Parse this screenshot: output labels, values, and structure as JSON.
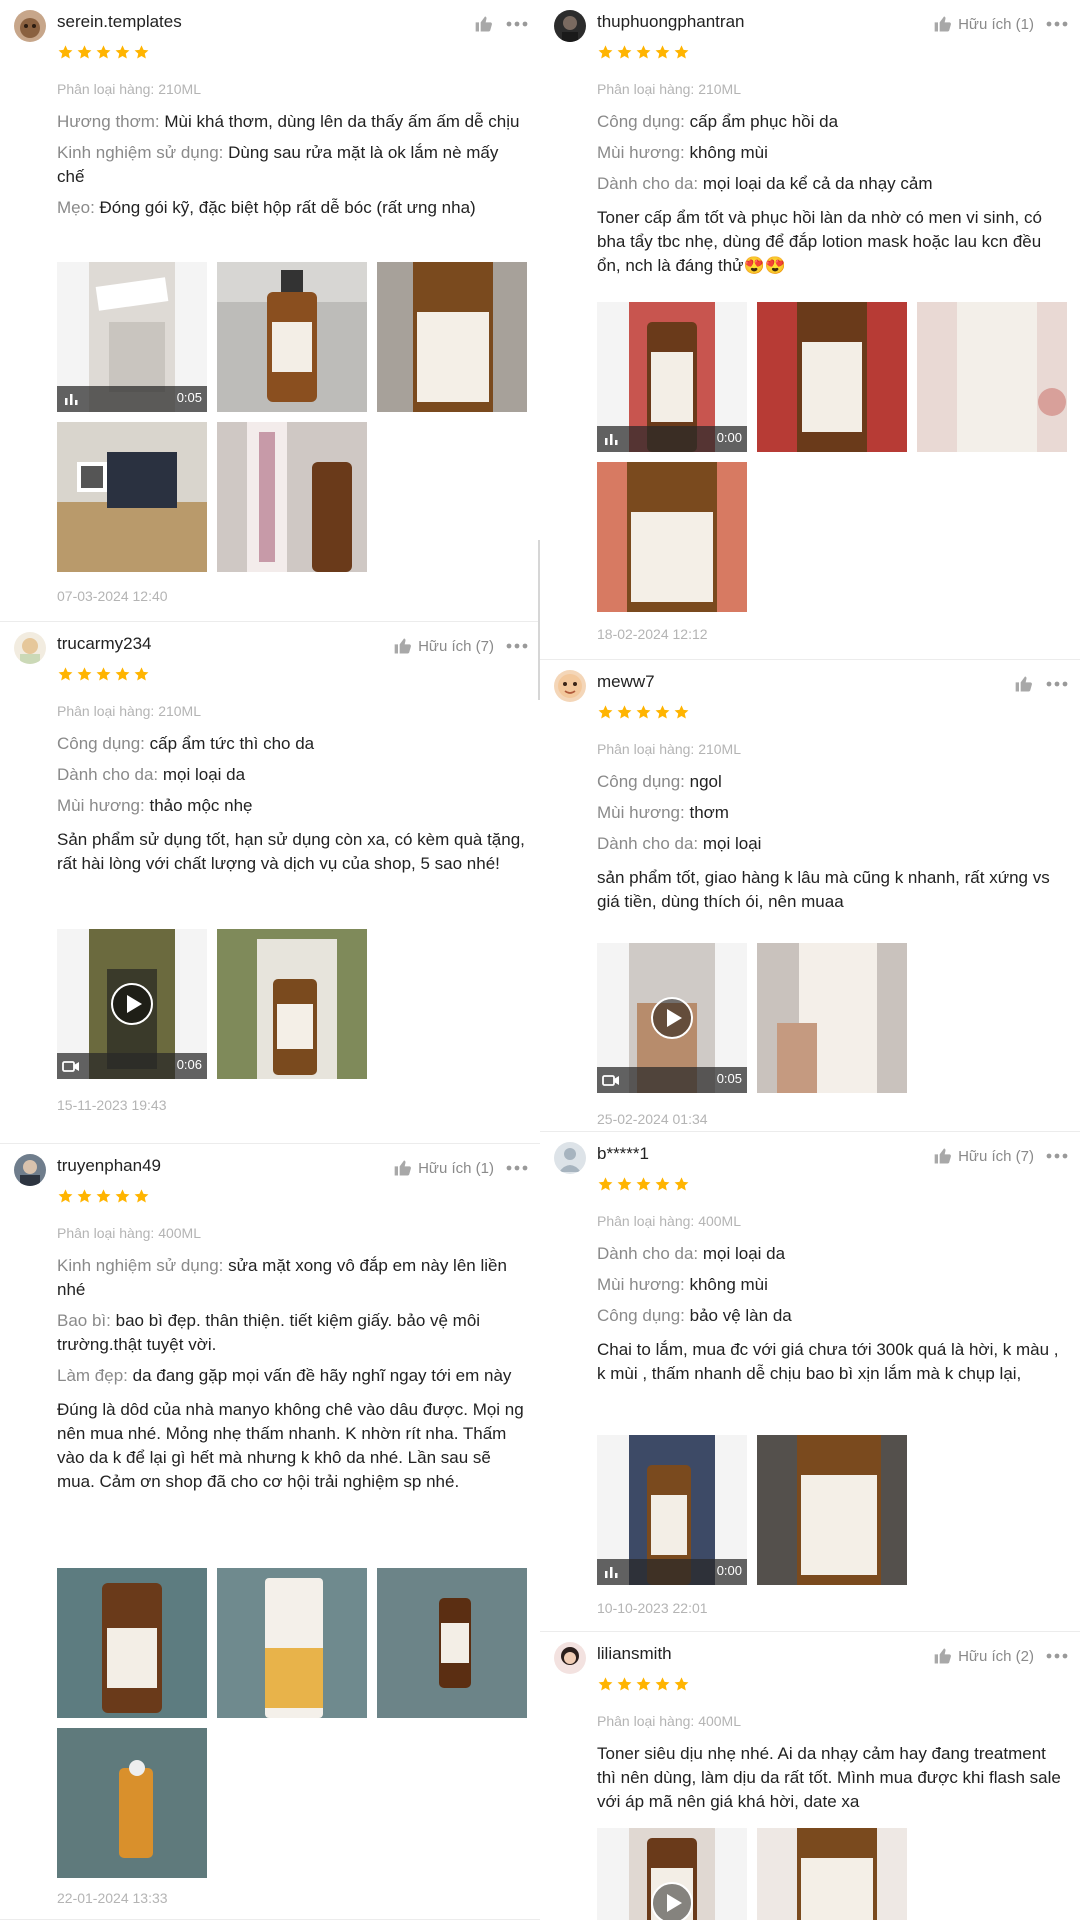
{
  "reviews": [
    {
      "username": "serein.templates",
      "helpful": "",
      "variant": "Phân loại hàng: 210ML",
      "attrs": [
        {
          "k": "Hương thơm: ",
          "v": "Mùi khá thơm, dùng lên da thấy ấm ấm dễ chịu"
        },
        {
          "k": "Kinh nghiệm sử dụng: ",
          "v": "Dùng sau rửa mặt là ok lắm nè mấy chế"
        },
        {
          "k": "Mẹo: ",
          "v": "Đóng gói kỹ, đặc biệt hộp rất dễ bóc (rất ưng nha)"
        }
      ],
      "body": "",
      "video_duration": "0:05",
      "date": "07-03-2024 12:40"
    },
    {
      "username": "trucarmy234",
      "helpful": "Hữu ích (7)",
      "variant": "Phân loại hàng: 210ML",
      "attrs": [
        {
          "k": "Công dụng: ",
          "v": "cấp ẩm tức thì cho da"
        },
        {
          "k": "Dành cho da: ",
          "v": "mọi loại da"
        },
        {
          "k": "Mùi hương: ",
          "v": "thảo mộc nhẹ"
        }
      ],
      "body": "Sản phẩm sử dụng tốt, hạn sử dụng còn xa, có kèm quà tặng, rất hài lòng với chất lượng và dịch vụ của shop, 5 sao nhé!",
      "video_duration": "0:06",
      "date": "15-11-2023 19:43"
    },
    {
      "username": "truyenphan49",
      "helpful": "Hữu ích (1)",
      "variant": "Phân loại hàng: 400ML",
      "attrs": [
        {
          "k": "Kinh nghiệm sử dụng: ",
          "v": "sửa mặt xong vô đắp em này lên liền nhé"
        },
        {
          "k": "Bao bì: ",
          "v": "bao bì đẹp. thân thiện. tiết kiệm giấy. bảo vệ môi trường.thật tuyệt vời."
        },
        {
          "k": "Làm đẹp: ",
          "v": "da đang gặp mọi vấn đề hãy nghĩ ngay tới em này"
        }
      ],
      "body": "Đúng là dôd của nhà manyo không chê vào dâu được. Mọi ng nên mua nhé. Mỏng nhẹ thấm nhanh. K nhờn rít nha. Thấm vào da k để lại gì hết mà nhưng k khô da nhé. Lần sau sẽ mua. Cảm ơn shop đã cho cơ hội trải nghiệm sp nhé.",
      "video_duration": "",
      "date": "22-01-2024 13:33"
    },
    {
      "username": "thuphuongphantran",
      "helpful": "Hữu ích (1)",
      "variant": "Phân loại hàng: 210ML",
      "attrs": [
        {
          "k": "Công dụng: ",
          "v": "cấp ẩm phục hồi da"
        },
        {
          "k": "Mùi hương: ",
          "v": "không mùi"
        },
        {
          "k": "Dành cho da: ",
          "v": "mọi loại da kể cả da nhạy cảm"
        }
      ],
      "body": "Toner cấp ẩm tốt và phục hồi làn da nhờ có men vi sinh, có bha tẩy tbc nhẹ, dùng để đắp lotion mask hoặc lau kcn đều ổn, nch là đáng thử😍😍",
      "video_duration": "0:00",
      "date": "18-02-2024 12:12"
    },
    {
      "username": "meww7",
      "helpful": "",
      "variant": "Phân loại hàng: 210ML",
      "attrs": [
        {
          "k": "Công dụng: ",
          "v": "ngol"
        },
        {
          "k": "Mùi hương: ",
          "v": "thơm"
        },
        {
          "k": "Dành cho da: ",
          "v": "mọi loại"
        }
      ],
      "body": "sản phẩm tốt, giao hàng k lâu mà cũng k nhanh, rất xứng vs giá tiền, dùng thích ói, nên muaa",
      "video_duration": "0:05",
      "date": "25-02-2024 01:34"
    },
    {
      "username": "b*****1",
      "helpful": "Hữu ích (7)",
      "variant": "Phân loại hàng: 400ML",
      "attrs": [
        {
          "k": "Dành cho da: ",
          "v": "mọi loại da"
        },
        {
          "k": "Mùi hương: ",
          "v": "không mùi"
        },
        {
          "k": "Công dụng: ",
          "v": "bảo vệ làn da"
        }
      ],
      "body": "Chai to lắm, mua đc với giá chưa tới 300k quá là hời, k màu , k mùi , thấm nhanh dễ chịu bao bì xịn lắm mà k chụp lại,",
      "video_duration": "0:00",
      "date": "10-10-2023 22:01"
    },
    {
      "username": "liliansmith",
      "helpful": "Hữu ích (2)",
      "variant": "Phân loại hàng: 400ML",
      "attrs": [],
      "body": "Toner siêu dịu nhẹ nhé. Ai da nhạy cảm hay đang treatment thì nên dùng, làm dịu da rất tốt. Mình mua được khi flash sale với áp mã nên giá khá hời, date xa",
      "video_duration": "",
      "date": ""
    }
  ],
  "colors": {
    "star": "#ffb400",
    "muted": "#8a8a8a",
    "faint": "#b4b4b4",
    "text": "#222222"
  }
}
